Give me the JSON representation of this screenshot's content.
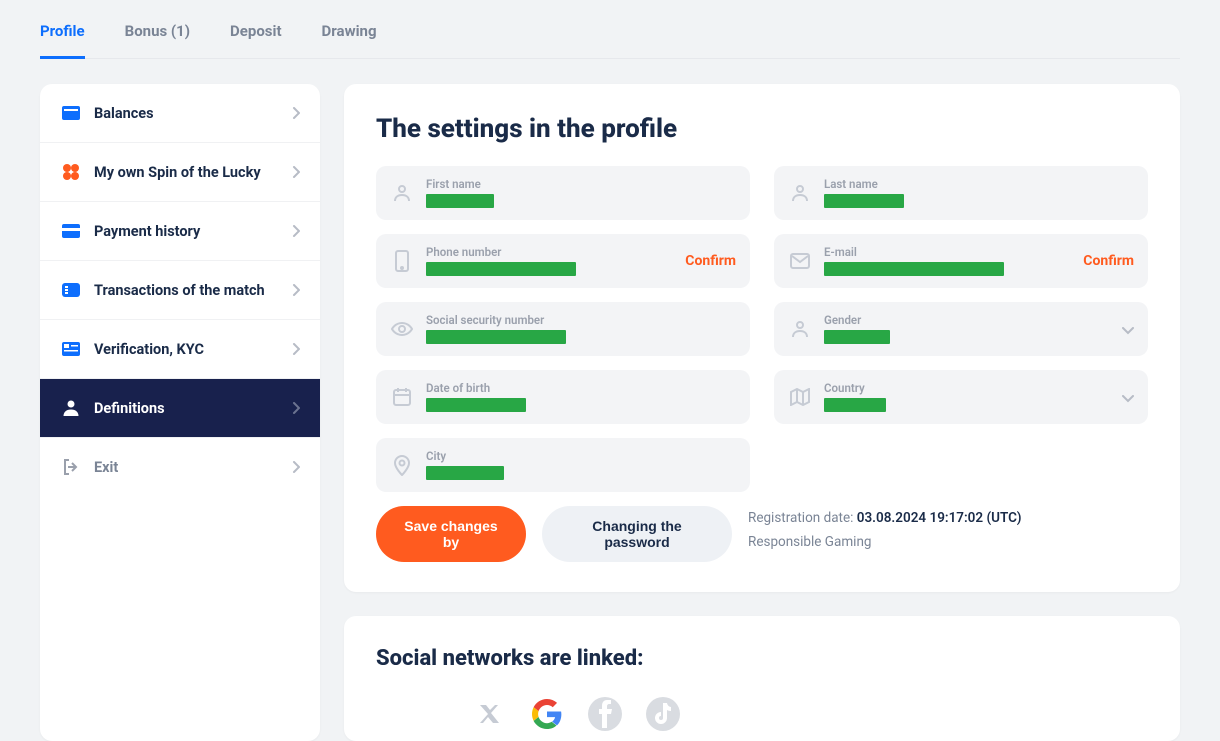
{
  "tabs": {
    "profile": "Profile",
    "bonus": "Bonus (1)",
    "deposit": "Deposit",
    "drawing": "Drawing"
  },
  "sidebar": {
    "items": [
      {
        "label": "Balances"
      },
      {
        "label": "My own Spin of the Lucky"
      },
      {
        "label": "Payment history"
      },
      {
        "label": "Transactions of the match"
      },
      {
        "label": "Verification, KYC"
      },
      {
        "label": "Definitions"
      },
      {
        "label": "Exit"
      }
    ]
  },
  "main": {
    "title": "The settings in the profile",
    "fields": {
      "first_name_label": "First name",
      "last_name_label": "Last name",
      "phone_label": "Phone number",
      "email_label": "E-mail",
      "ssn_label": "Social security number",
      "gender_label": "Gender",
      "dob_label": "Date of birth",
      "country_label": "Country",
      "city_label": "City"
    },
    "confirm_label": "Confirm",
    "save_button": "Save changes by",
    "change_pw_button": "Changing the password",
    "meta": {
      "reg_label": "Registration date:",
      "reg_value": "03.08.2024 19:17:02 (UTC)",
      "responsible": "Responsible Gaming"
    }
  },
  "social": {
    "title": "Social networks are linked:"
  }
}
